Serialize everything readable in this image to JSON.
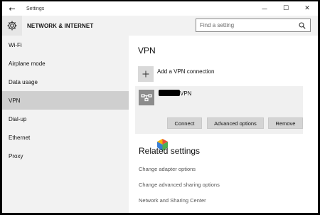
{
  "window": {
    "title": "Settings",
    "back_glyph": "←",
    "minimize_glyph": "—",
    "maximize_glyph": "☐",
    "close_glyph": "✕"
  },
  "header": {
    "section_title": "NETWORK & INTERNET",
    "section_icon": "gear-icon",
    "search": {
      "placeholder": "Find a setting",
      "icon": "search-icon"
    }
  },
  "sidebar": {
    "items": [
      {
        "label": "Wi-Fi",
        "active": false
      },
      {
        "label": "Airplane mode",
        "active": false
      },
      {
        "label": "Data usage",
        "active": false
      },
      {
        "label": "VPN",
        "active": true
      },
      {
        "label": "Dial-up",
        "active": false
      },
      {
        "label": "Ethernet",
        "active": false
      },
      {
        "label": "Proxy",
        "active": false
      }
    ]
  },
  "main": {
    "title": "VPN",
    "add_vpn": {
      "icon": "plus-icon",
      "label": "Add a VPN connection"
    },
    "connection": {
      "icon": "vpn-network-icon",
      "name_suffix": "VPN",
      "buttons": {
        "connect": "Connect",
        "advanced": "Advanced options",
        "remove": "Remove"
      }
    },
    "related": {
      "title": "Related settings",
      "links": [
        "Change adapter options",
        "Change advanced sharing options",
        "Network and Sharing Center"
      ]
    }
  },
  "colors": {
    "sidebar_bg": "#f2f2f2",
    "active_item_bg": "#cfcfcf",
    "button_bg": "#d4d4d4",
    "vpn_tile_bg": "#8c8c8c",
    "link_color": "#555555"
  }
}
